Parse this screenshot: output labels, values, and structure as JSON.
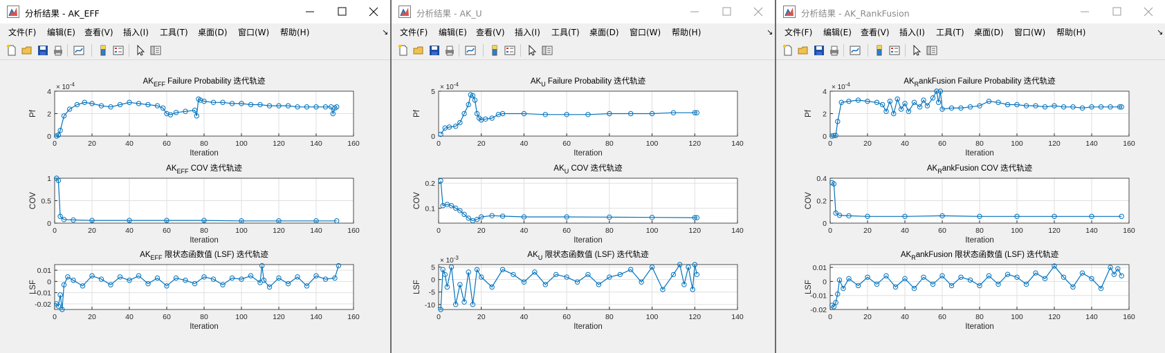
{
  "menu": [
    "文件(F)",
    "编辑(E)",
    "查看(V)",
    "插入(I)",
    "工具(T)",
    "桌面(D)",
    "窗口(W)",
    "帮助(H)"
  ],
  "menu_more": "↘",
  "colors": {
    "series": "#0072bd",
    "grid": "#dfdfdf",
    "axes": "#262626",
    "background": "#f0f0f0"
  },
  "toolbar_icons": [
    "new-figure-icon",
    "open-file-icon",
    "save-icon",
    "print-icon",
    "link-plot-icon",
    "insert-colorbar-icon",
    "insert-legend-icon",
    "edit-plot-pointer-icon",
    "property-inspector-icon"
  ],
  "windows": [
    {
      "title": "分析结果 - AK_EFF",
      "active": true,
      "plots": [
        {
          "title_prefix": "AK",
          "title_sub": "EFF",
          "title_rest": " Failure Probability 迭代轨迹",
          "ylabel": "Pf",
          "xlabel": "Iteration",
          "exponent_label": "× 10",
          "exponent_value": "-4",
          "y_ticks": [
            "0",
            "2",
            "4"
          ],
          "x_ticks": [
            "0",
            "20",
            "40",
            "60",
            "80",
            "100",
            "120",
            "140",
            "160"
          ]
        },
        {
          "title_prefix": "AK",
          "title_sub": "EFF",
          "title_rest": " COV 迭代轨迹",
          "ylabel": "COV",
          "xlabel": "Iteration",
          "y_ticks": [
            "0",
            "0.5",
            "1"
          ],
          "x_ticks": [
            "0",
            "20",
            "40",
            "60",
            "80",
            "100",
            "120",
            "140",
            "160"
          ]
        },
        {
          "title_prefix": "AK",
          "title_sub": "EFF",
          "title_rest": " 限状态函数值 (LSF) 迭代轨迹",
          "ylabel": "LSF",
          "xlabel": "Iteration",
          "y_ticks": [
            "-0.02",
            "-0.01",
            "0",
            "0.01"
          ],
          "x_ticks": [
            "0",
            "20",
            "40",
            "60",
            "80",
            "100",
            "120",
            "140",
            "160"
          ]
        }
      ]
    },
    {
      "title": "分析结果 - AK_U",
      "active": false,
      "plots": [
        {
          "title_prefix": "AK",
          "title_sub": "U",
          "title_rest": " Failure Probability 迭代轨迹",
          "ylabel": "Pf",
          "xlabel": "Iteration",
          "exponent_label": "× 10",
          "exponent_value": "-4",
          "y_ticks": [
            "0",
            "5"
          ],
          "x_ticks": [
            "0",
            "20",
            "40",
            "60",
            "80",
            "100",
            "120",
            "140"
          ]
        },
        {
          "title_prefix": "AK",
          "title_sub": "U",
          "title_rest": " COV 迭代轨迹",
          "ylabel": "COV",
          "xlabel": "Iteration",
          "y_ticks": [
            "0.1",
            "0.2"
          ],
          "x_ticks": [
            "0",
            "20",
            "40",
            "60",
            "80",
            "100",
            "120",
            "140"
          ]
        },
        {
          "title_prefix": "AK",
          "title_sub": "U",
          "title_rest": " 限状态函数值 (LSF) 迭代轨迹",
          "ylabel": "LSF",
          "xlabel": "Iteration",
          "exponent_label": "× 10",
          "exponent_value": "-3",
          "y_ticks": [
            "-10",
            "-5",
            "0",
            "5"
          ],
          "x_ticks": [
            "0",
            "20",
            "40",
            "60",
            "80",
            "100",
            "120",
            "140"
          ]
        }
      ]
    },
    {
      "title": "分析结果 - AK_RankFusion",
      "active": false,
      "plots": [
        {
          "title_prefix": "AK",
          "title_sub": "R",
          "title_rest": "ankFusion Failure Probability 迭代轨迹",
          "ylabel": "Pf",
          "xlabel": "Iteration",
          "exponent_label": "× 10",
          "exponent_value": "-4",
          "y_ticks": [
            "0",
            "2",
            "4"
          ],
          "x_ticks": [
            "0",
            "20",
            "40",
            "60",
            "80",
            "100",
            "120",
            "140",
            "160"
          ]
        },
        {
          "title_prefix": "AK",
          "title_sub": "R",
          "title_rest": "ankFusion COV 迭代轨迹",
          "ylabel": "COV",
          "xlabel": "Iteration",
          "y_ticks": [
            "0",
            "0.2",
            "0.4"
          ],
          "x_ticks": [
            "0",
            "20",
            "40",
            "60",
            "80",
            "100",
            "120",
            "140",
            "160"
          ]
        },
        {
          "title_prefix": "AK",
          "title_sub": "R",
          "title_rest": "ankFusion 限状态函数值 (LSF) 迭代轨迹",
          "ylabel": "LSF",
          "xlabel": "Iteration",
          "y_ticks": [
            "-0.02",
            "-0.01",
            "0",
            "0.01"
          ],
          "x_ticks": [
            "0",
            "20",
            "40",
            "60",
            "80",
            "100",
            "120",
            "140",
            "160"
          ]
        }
      ]
    }
  ],
  "chart_data": [
    {
      "type": "line",
      "title": "AK_EFF Failure Probability 迭代轨迹",
      "xlabel": "Iteration",
      "ylabel": "Pf",
      "xlim": [
        0,
        160
      ],
      "ylim": [
        0,
        0.0004
      ],
      "grid": true,
      "marker": "circle",
      "x": [
        1,
        2,
        3,
        5,
        8,
        12,
        16,
        20,
        25,
        30,
        35,
        40,
        45,
        50,
        55,
        58,
        60,
        62,
        65,
        70,
        75,
        76,
        77,
        78,
        80,
        85,
        90,
        95,
        100,
        105,
        110,
        115,
        120,
        125,
        130,
        135,
        140,
        145,
        148,
        149,
        150,
        151
      ],
      "values": [
        0,
        1e-05,
        5e-05,
        0.00018,
        0.00024,
        0.00028,
        0.0003,
        0.00029,
        0.00027,
        0.00026,
        0.00028,
        0.0003,
        0.00029,
        0.00028,
        0.00027,
        0.00025,
        0.0002,
        0.00019,
        0.00021,
        0.00022,
        0.00023,
        0.00018,
        0.00033,
        0.00032,
        0.00031,
        0.0003,
        0.0003,
        0.00029,
        0.00029,
        0.00028,
        0.00028,
        0.00027,
        0.00027,
        0.00027,
        0.00026,
        0.00026,
        0.00026,
        0.00026,
        0.00026,
        0.0002,
        0.00025,
        0.00026
      ]
    },
    {
      "type": "line",
      "title": "AK_EFF COV 迭代轨迹",
      "xlabel": "Iteration",
      "ylabel": "COV",
      "xlim": [
        0,
        160
      ],
      "ylim": [
        0,
        1
      ],
      "grid": true,
      "marker": "circle",
      "x": [
        1,
        2,
        3,
        5,
        10,
        20,
        40,
        60,
        80,
        100,
        120,
        140,
        151
      ],
      "values": [
        1.0,
        0.95,
        0.15,
        0.08,
        0.07,
        0.06,
        0.06,
        0.06,
        0.06,
        0.05,
        0.05,
        0.05,
        0.05
      ]
    },
    {
      "type": "line",
      "title": "AK_EFF 限状态函数值 (LSF) 迭代轨迹",
      "xlabel": "Iteration",
      "ylabel": "LSF",
      "xlim": [
        0,
        160
      ],
      "ylim": [
        -0.025,
        0.015
      ],
      "grid": true,
      "marker": "circle",
      "x": [
        1,
        2,
        3,
        4,
        5,
        7,
        10,
        15,
        20,
        25,
        30,
        35,
        40,
        45,
        50,
        55,
        60,
        65,
        70,
        75,
        80,
        85,
        90,
        95,
        100,
        105,
        110,
        111,
        112,
        115,
        120,
        125,
        130,
        135,
        140,
        145,
        150,
        152
      ],
      "values": [
        -0.02,
        -0.022,
        -0.012,
        -0.025,
        -0.003,
        0.004,
        0.001,
        -0.004,
        0.005,
        0.002,
        -0.003,
        0.004,
        0.001,
        0.005,
        -0.002,
        0.003,
        -0.004,
        0.003,
        0.001,
        -0.002,
        0.004,
        0.002,
        -0.003,
        0.003,
        0.002,
        0.005,
        -0.001,
        0.014,
        0.001,
        -0.005,
        0.003,
        -0.002,
        0.004,
        -0.004,
        0.005,
        0.002,
        0.003,
        0.014
      ]
    },
    {
      "type": "line",
      "title": "AK_U Failure Probability 迭代轨迹",
      "xlabel": "Iteration",
      "ylabel": "Pf",
      "xlim": [
        0,
        140
      ],
      "ylim": [
        0,
        0.0005
      ],
      "grid": true,
      "marker": "circle",
      "x": [
        1,
        3,
        5,
        8,
        10,
        12,
        14,
        15,
        16,
        17,
        18,
        19,
        20,
        22,
        25,
        28,
        30,
        40,
        50,
        60,
        70,
        80,
        90,
        100,
        110,
        120,
        121
      ],
      "values": [
        2e-05,
        9e-05,
        0.0001,
        0.00011,
        0.00015,
        0.00025,
        0.00035,
        0.00046,
        0.00045,
        0.0004,
        0.00025,
        0.0002,
        0.00018,
        0.00019,
        0.0002,
        0.00024,
        0.00025,
        0.00025,
        0.00024,
        0.00024,
        0.00024,
        0.00025,
        0.00025,
        0.00025,
        0.00026,
        0.00026,
        0.00026
      ]
    },
    {
      "type": "line",
      "title": "AK_U COV 迭代轨迹",
      "xlabel": "Iteration",
      "ylabel": "COV",
      "xlim": [
        0,
        140
      ],
      "ylim": [
        0.04,
        0.22
      ],
      "grid": true,
      "marker": "circle",
      "x": [
        1,
        2,
        4,
        6,
        8,
        10,
        12,
        14,
        16,
        18,
        20,
        25,
        30,
        40,
        60,
        80,
        100,
        120,
        121
      ],
      "values": [
        0.21,
        0.11,
        0.115,
        0.11,
        0.1,
        0.09,
        0.075,
        0.06,
        0.05,
        0.055,
        0.065,
        0.07,
        0.068,
        0.065,
        0.065,
        0.064,
        0.063,
        0.062,
        0.062
      ]
    },
    {
      "type": "line",
      "title": "AK_U 限状态函数值 (LSF) 迭代轨迹",
      "xlabel": "Iteration",
      "ylabel": "LSF",
      "xlim": [
        0,
        140
      ],
      "ylim": [
        -0.012,
        0.006
      ],
      "grid": true,
      "marker": "circle",
      "x": [
        1,
        2,
        3,
        4,
        6,
        8,
        10,
        12,
        14,
        16,
        18,
        20,
        25,
        30,
        35,
        40,
        45,
        50,
        55,
        60,
        65,
        70,
        75,
        80,
        85,
        90,
        95,
        100,
        105,
        110,
        113,
        115,
        117,
        119,
        120,
        121
      ],
      "values": [
        -0.012,
        0.004,
        0.002,
        -0.003,
        0.005,
        -0.01,
        -0.002,
        -0.009,
        0.003,
        -0.01,
        0.004,
        0.001,
        -0.003,
        0.004,
        0.002,
        -0.001,
        0.003,
        -0.002,
        0.002,
        0.001,
        -0.001,
        0.002,
        -0.002,
        0.001,
        0.002,
        0.004,
        -0.001,
        0.005,
        -0.004,
        0.002,
        0.006,
        -0.002,
        0.005,
        -0.004,
        0.006,
        0.002
      ]
    },
    {
      "type": "line",
      "title": "AK_RankFusion Failure Probability 迭代轨迹",
      "xlabel": "Iteration",
      "ylabel": "Pf",
      "xlim": [
        0,
        160
      ],
      "ylim": [
        0,
        0.0004
      ],
      "grid": true,
      "marker": "circle",
      "x": [
        1,
        2,
        3,
        4,
        6,
        10,
        15,
        20,
        25,
        28,
        30,
        32,
        34,
        36,
        38,
        40,
        42,
        45,
        48,
        50,
        52,
        55,
        57,
        58,
        59,
        60,
        65,
        70,
        75,
        80,
        85,
        90,
        95,
        100,
        105,
        110,
        115,
        120,
        125,
        130,
        135,
        140,
        145,
        150,
        155,
        156
      ],
      "values": [
        0,
        5e-06,
        5e-06,
        0.00013,
        0.0003,
        0.00031,
        0.00032,
        0.00031,
        0.0003,
        0.00028,
        0.00022,
        0.00031,
        0.0002,
        0.00033,
        0.00024,
        0.00029,
        0.00022,
        0.0003,
        0.00026,
        0.00032,
        0.00027,
        0.00034,
        0.0004,
        0.0003,
        0.0004,
        0.00024,
        0.00025,
        0.00025,
        0.00026,
        0.00027,
        0.00031,
        0.0003,
        0.00028,
        0.00028,
        0.00027,
        0.00027,
        0.00026,
        0.00027,
        0.00026,
        0.00026,
        0.00025,
        0.00026,
        0.00026,
        0.00026,
        0.00026,
        0.00026
      ]
    },
    {
      "type": "line",
      "title": "AK_RankFusion COV 迭代轨迹",
      "xlabel": "Iteration",
      "ylabel": "COV",
      "xlim": [
        0,
        160
      ],
      "ylim": [
        0,
        0.4
      ],
      "grid": true,
      "marker": "circle",
      "x": [
        1,
        2,
        3,
        5,
        10,
        20,
        40,
        60,
        80,
        100,
        120,
        140,
        156
      ],
      "values": [
        0.36,
        0.35,
        0.09,
        0.07,
        0.065,
        0.06,
        0.06,
        0.065,
        0.06,
        0.06,
        0.06,
        0.06,
        0.06
      ]
    },
    {
      "type": "line",
      "title": "AK_RankFusion 限状态函数值 (LSF) 迭代轨迹",
      "xlabel": "Iteration",
      "ylabel": "LSF",
      "xlim": [
        0,
        160
      ],
      "ylim": [
        -0.02,
        0.012
      ],
      "grid": true,
      "marker": "circle",
      "x": [
        1,
        2,
        3,
        4,
        5,
        7,
        10,
        15,
        20,
        25,
        30,
        35,
        40,
        45,
        50,
        55,
        60,
        65,
        70,
        75,
        80,
        85,
        90,
        95,
        100,
        105,
        110,
        115,
        120,
        125,
        130,
        135,
        140,
        145,
        150,
        152,
        154,
        156
      ],
      "values": [
        -0.017,
        -0.018,
        -0.015,
        -0.009,
        0.001,
        -0.005,
        0.002,
        -0.003,
        0.003,
        -0.002,
        0.004,
        -0.004,
        0.002,
        -0.005,
        0.003,
        -0.002,
        0.004,
        -0.003,
        0.003,
        0.001,
        -0.003,
        0.004,
        -0.002,
        0.005,
        0.003,
        -0.002,
        0.006,
        0.002,
        0.011,
        0.003,
        -0.004,
        0.006,
        0.002,
        -0.005,
        0.01,
        0.005,
        0.009,
        0.004
      ]
    }
  ]
}
